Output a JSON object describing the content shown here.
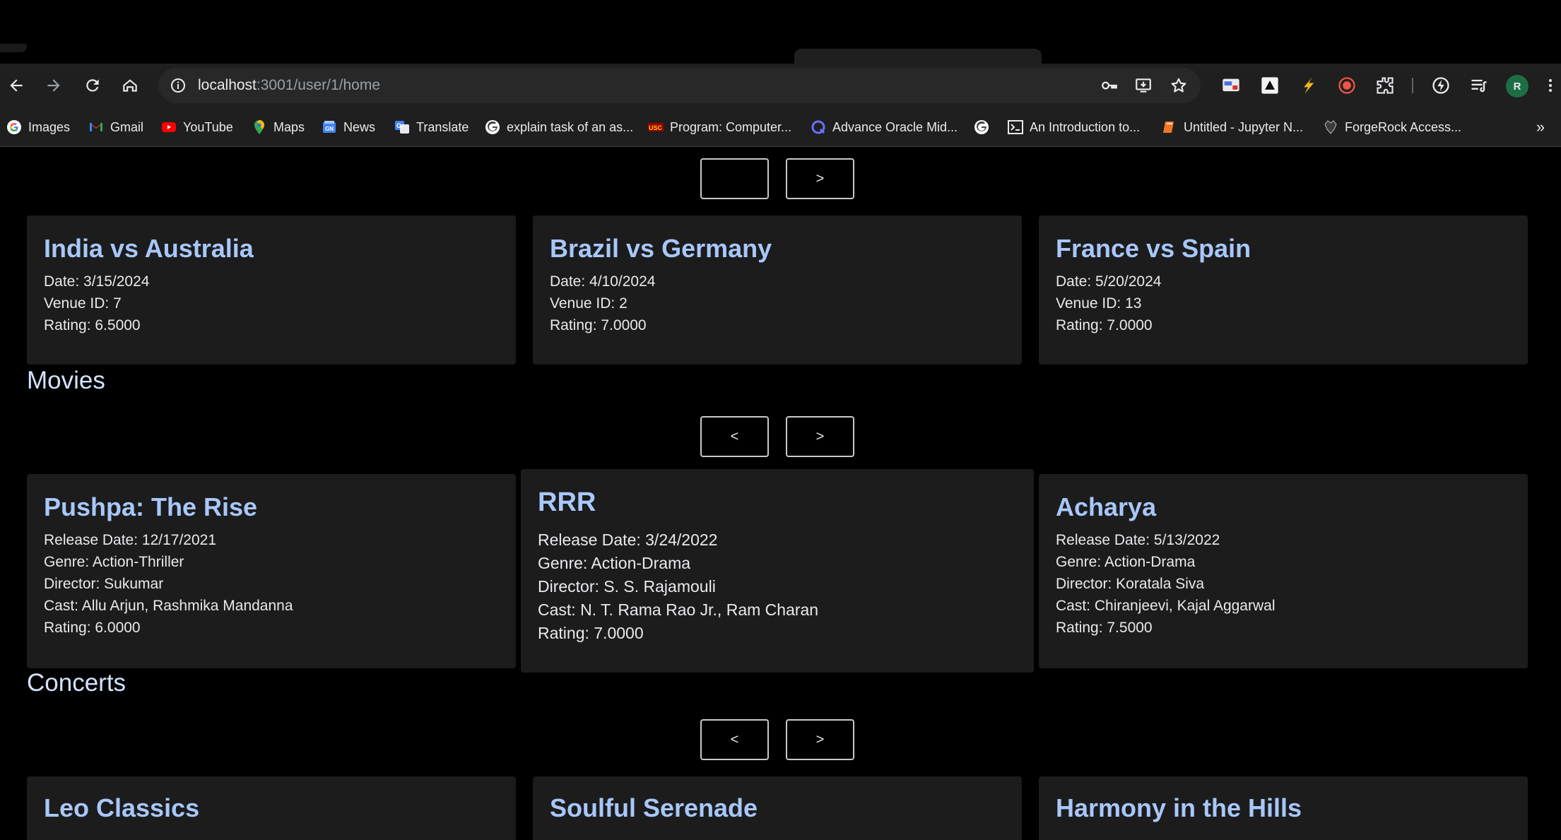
{
  "browser": {
    "url_host": "localhost",
    "url_path": ":3001/user/1/home",
    "avatar_letter": "R",
    "bookmarks": [
      {
        "label": "Images",
        "icon": "google-icon"
      },
      {
        "label": "Gmail",
        "icon": "gmail-icon"
      },
      {
        "label": "YouTube",
        "icon": "youtube-icon"
      },
      {
        "label": "Maps",
        "icon": "maps-icon"
      },
      {
        "label": "News",
        "icon": "news-icon"
      },
      {
        "label": "Translate",
        "icon": "translate-icon"
      },
      {
        "label": "explain task of an as...",
        "icon": "google-icon"
      },
      {
        "label": "Program: Computer...",
        "icon": "usc-icon"
      },
      {
        "label": "Advance Oracle Mid...",
        "icon": "quiz-icon"
      },
      {
        "label": "",
        "icon": "google-icon"
      },
      {
        "label": "An Introduction to...",
        "icon": "terminal-icon"
      },
      {
        "label": "Untitled - Jupyter N...",
        "icon": "jupyter-icon"
      },
      {
        "label": "ForgeRock Access...",
        "icon": "forgerock-icon"
      }
    ],
    "more_bookmarks": "»"
  },
  "sports": {
    "prev_label": "",
    "next_label": ">",
    "cards": [
      {
        "title": "India vs Australia",
        "lines": [
          "Date: 3/15/2024",
          "Venue ID: 7",
          "Rating: 6.5000"
        ]
      },
      {
        "title": "Brazil vs Germany",
        "lines": [
          "Date: 4/10/2024",
          "Venue ID: 2",
          "Rating: 7.0000"
        ]
      },
      {
        "title": "France vs Spain",
        "lines": [
          "Date: 5/20/2024",
          "Venue ID: 13",
          "Rating: 7.0000"
        ]
      }
    ]
  },
  "movies": {
    "title": "Movies",
    "prev_label": "<",
    "next_label": ">",
    "cards": [
      {
        "title": "Pushpa: The Rise",
        "lines": [
          "Release Date: 12/17/2021",
          "Genre: Action-Thriller",
          "Director: Sukumar",
          "Cast: Allu Arjun, Rashmika Mandanna",
          "Rating: 6.0000"
        ]
      },
      {
        "title": "RRR",
        "lines": [
          "Release Date: 3/24/2022",
          "Genre: Action-Drama",
          "Director: S. S. Rajamouli",
          "Cast: N. T. Rama Rao Jr., Ram Charan",
          "Rating: 7.0000"
        ]
      },
      {
        "title": "Acharya",
        "lines": [
          "Release Date: 5/13/2022",
          "Genre: Action-Drama",
          "Director: Koratala Siva",
          "Cast: Chiranjeevi, Kajal Aggarwal",
          "Rating: 7.5000"
        ]
      }
    ]
  },
  "concerts": {
    "title": "Concerts",
    "prev_label": "<",
    "next_label": ">",
    "cards": [
      {
        "title": "Leo Classics"
      },
      {
        "title": "Soulful Serenade"
      },
      {
        "title": "Harmony in the Hills"
      }
    ]
  }
}
